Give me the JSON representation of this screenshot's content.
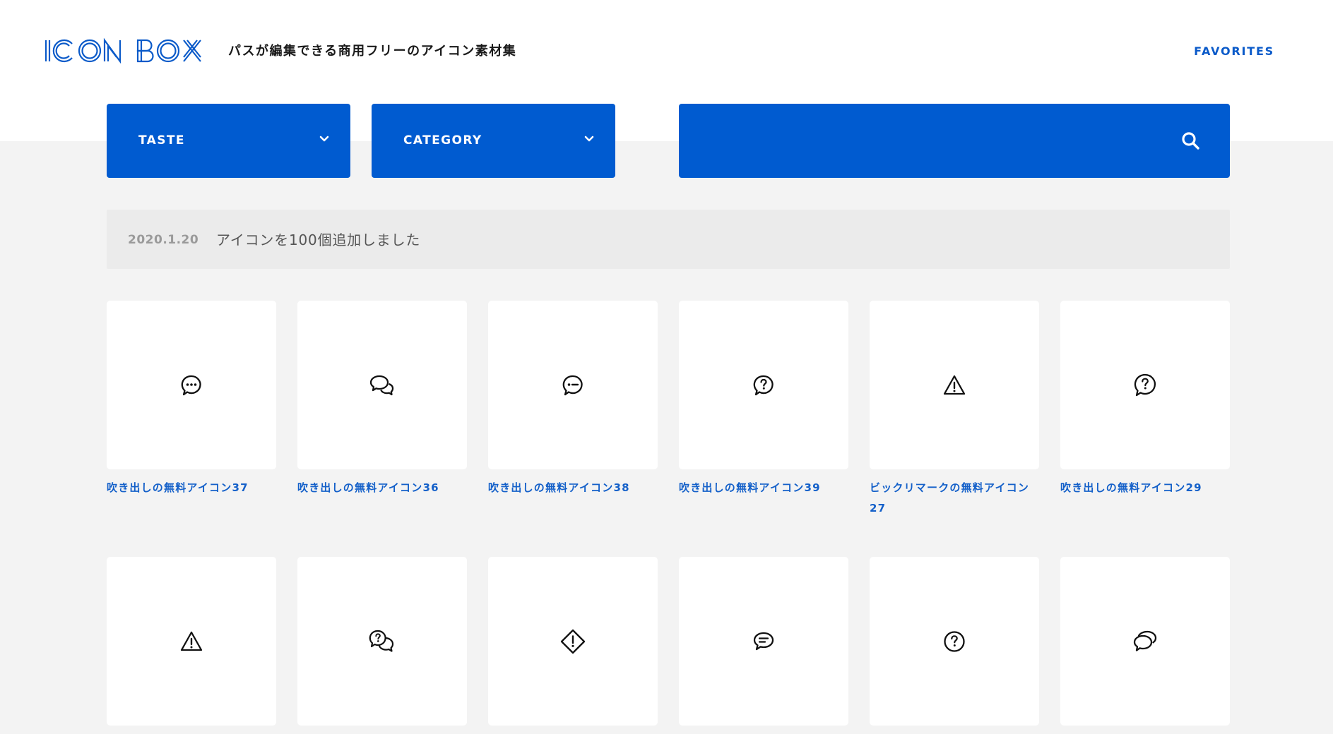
{
  "header": {
    "logo_text": "ICON BOX",
    "tagline": "パスが編集できる商用フリーのアイコン素材集",
    "favorites_label": "FAVORITES"
  },
  "filters": {
    "taste_label": "TASTE",
    "category_label": "CATEGORY"
  },
  "search": {
    "value": "",
    "placeholder": ""
  },
  "news": {
    "date": "2020.1.20",
    "text": "アイコンを100個追加しました"
  },
  "icons": [
    {
      "title": "吹き出しの無料アイコン37",
      "icon": "speech-bubble-dots-icon"
    },
    {
      "title": "吹き出しの無料アイコン36",
      "icon": "double-speech-bubble-icon"
    },
    {
      "title": "吹き出しの無料アイコン38",
      "icon": "speech-bubble-dash-icon"
    },
    {
      "title": "吹き出しの無料アイコン39",
      "icon": "question-bubble-icon"
    },
    {
      "title": "ビックリマークの無料アイコン27",
      "icon": "warning-triangle-icon"
    },
    {
      "title": "吹き出しの無料アイコン29",
      "icon": "question-bubble-icon"
    },
    {
      "title": "",
      "icon": "warning-triangle-icon"
    },
    {
      "title": "",
      "icon": "question-double-bubble-icon"
    },
    {
      "title": "",
      "icon": "warning-diamond-icon"
    },
    {
      "title": "",
      "icon": "text-lines-bubble-icon"
    },
    {
      "title": "",
      "icon": "question-circle-icon"
    },
    {
      "title": "",
      "icon": "double-speech-bubble-icon"
    }
  ],
  "colors": {
    "brand_blue": "#005bd0",
    "link_blue": "#1460c9",
    "page_bg": "#f3f3f3"
  }
}
